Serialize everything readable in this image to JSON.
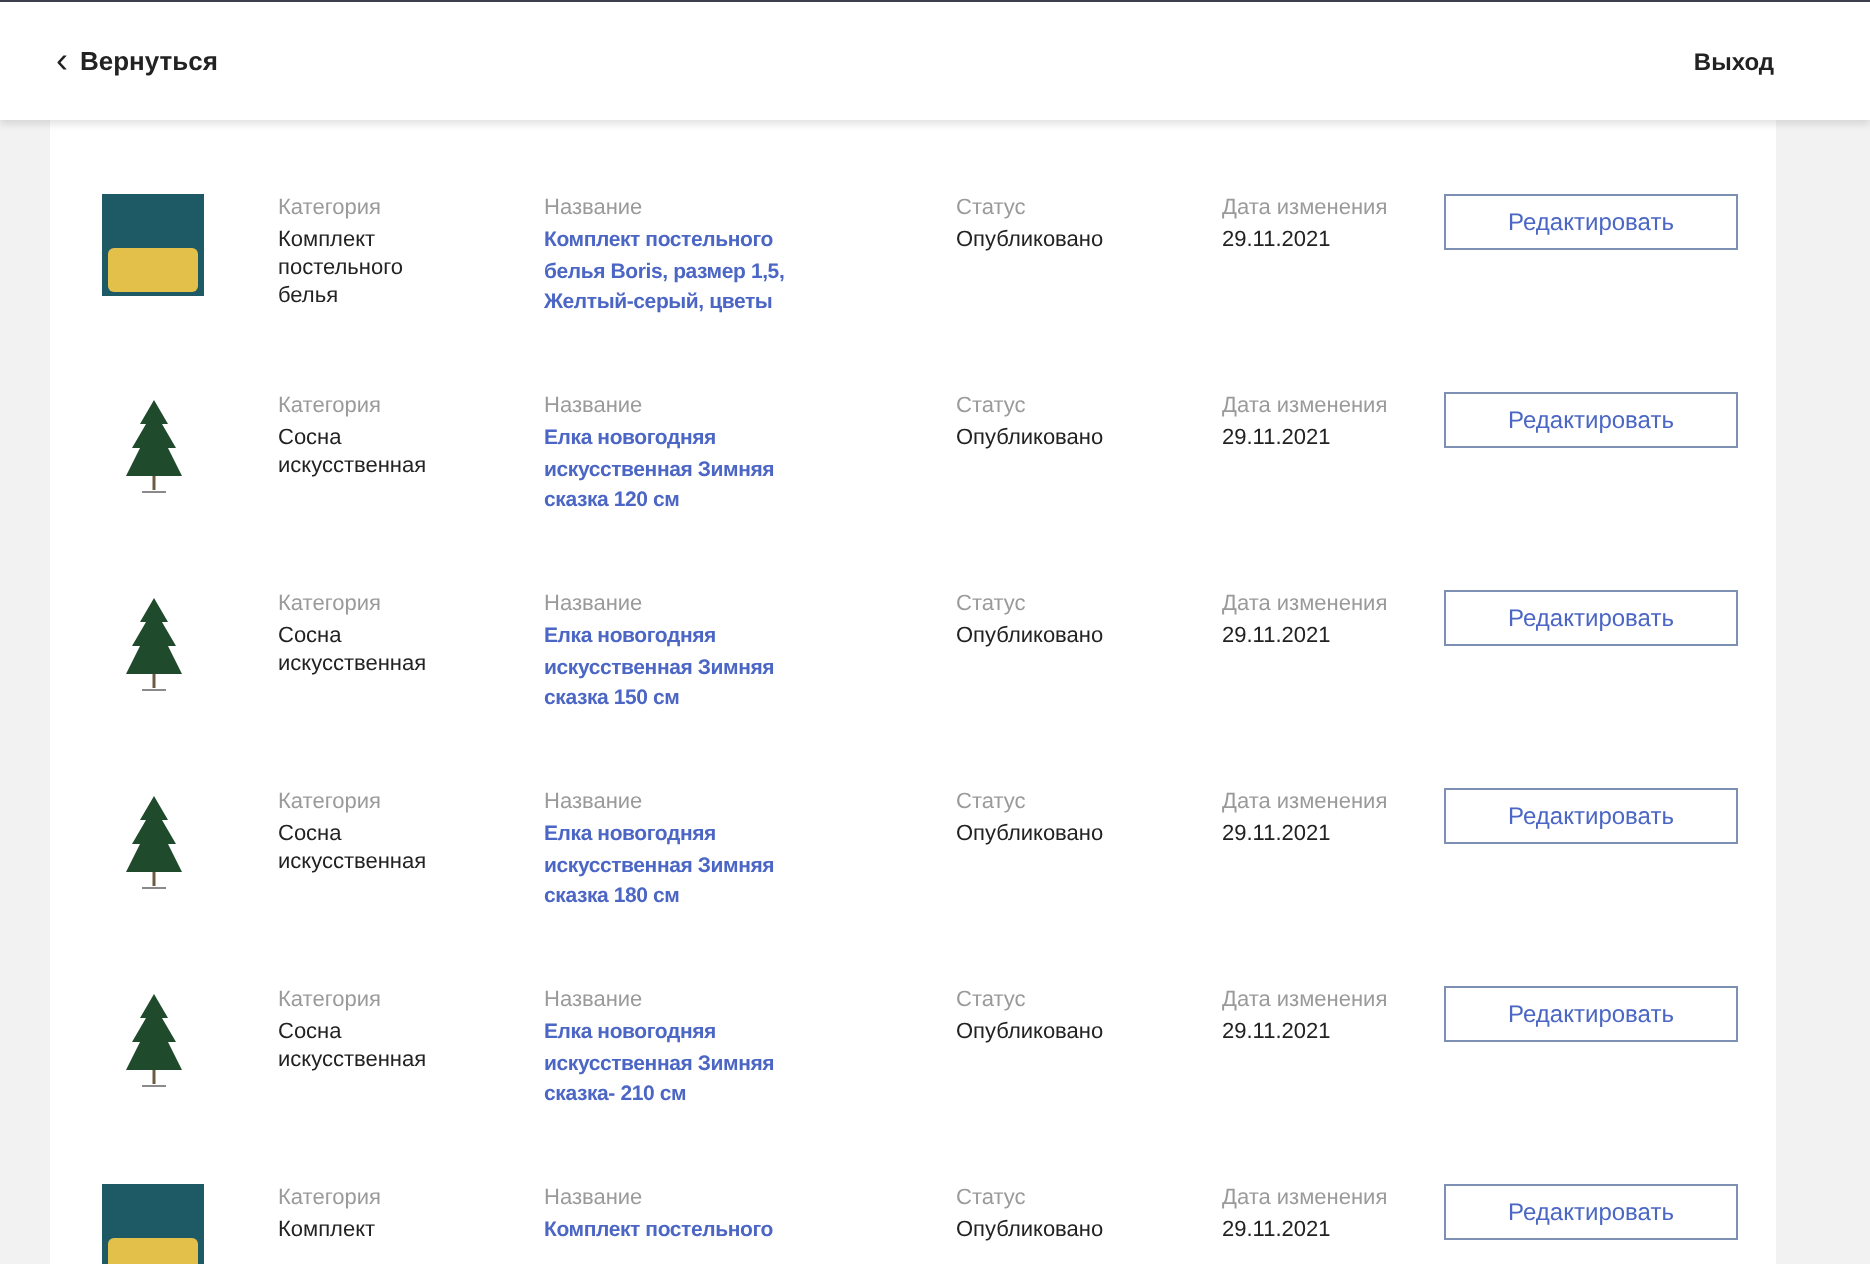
{
  "header": {
    "back_icon": "‹",
    "back_label": "Вернуться",
    "logout": "Выход"
  },
  "rows": [
    {
      "kind": "bedding",
      "category_label": "Категория",
      "category": "Комплект постельного белья",
      "name_label": "Название",
      "name": "Комплект постельного белья Boris, размер 1,5, Желтый-серый, цветы",
      "status_label": "Статус",
      "status": "Опубликовано",
      "date_label": "Дата изменения",
      "date": "29.11.2021",
      "button": "Редактировать"
    },
    {
      "kind": "tree",
      "category_label": "Категория",
      "category": "Сосна искусственная",
      "name_label": "Название",
      "name": "Елка новогодняя искусственная Зимняя сказка 120 см",
      "status_label": "Статус",
      "status": "Опубликовано",
      "date_label": "Дата изменения",
      "date": "29.11.2021",
      "button": "Редактировать"
    },
    {
      "kind": "tree",
      "category_label": "Категория",
      "category": "Сосна искусственная",
      "name_label": "Название",
      "name": "Елка новогодняя искусственная Зимняя сказка 150 см",
      "status_label": "Статус",
      "status": "Опубликовано",
      "date_label": "Дата изменения",
      "date": "29.11.2021",
      "button": "Редактировать"
    },
    {
      "kind": "tree",
      "category_label": "Категория",
      "category": "Сосна искусственная",
      "name_label": "Название",
      "name": "Елка новогодняя искусственная Зимняя сказка 180 см",
      "status_label": "Статус",
      "status": "Опубликовано",
      "date_label": "Дата изменения",
      "date": "29.11.2021",
      "button": "Редактировать"
    },
    {
      "kind": "tree",
      "category_label": "Категория",
      "category": "Сосна искусственная",
      "name_label": "Название",
      "name": "Елка новогодняя искусственная Зимняя сказка- 210 см",
      "status_label": "Статус",
      "status": "Опубликовано",
      "date_label": "Дата изменения",
      "date": "29.11.2021",
      "button": "Редактировать"
    },
    {
      "kind": "bedding",
      "category_label": "Категория",
      "category": "Комплект",
      "name_label": "Название",
      "name": "Комплект постельного",
      "status_label": "Статус",
      "status": "Опубликовано",
      "date_label": "Дата изменения",
      "date": "29.11.2021",
      "button": "Редактировать"
    }
  ]
}
